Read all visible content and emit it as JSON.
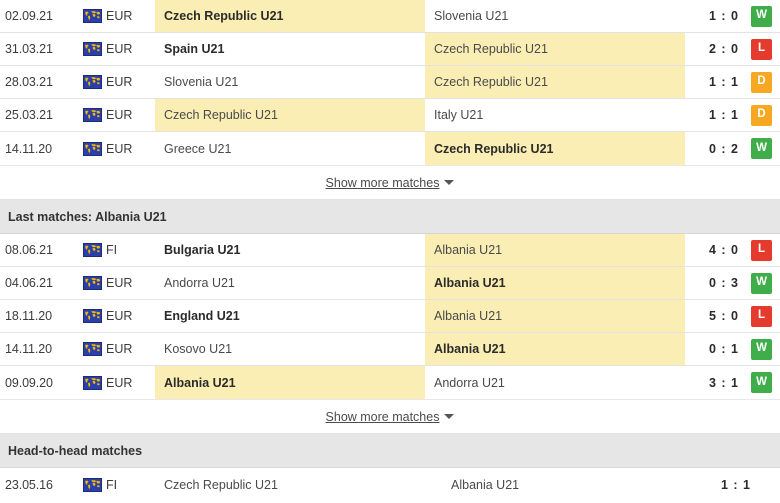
{
  "colors": {
    "win": "#3fae4a",
    "loss": "#e53b2e",
    "draw": "#f7a823",
    "highlight": "#faeeb4",
    "section_bg": "#e6e6e6",
    "flag_bg": "#2b3fa8",
    "flag_fg": "#f2b705"
  },
  "icons": {
    "flag": "world-map-icon",
    "caret": "chevron-down-icon"
  },
  "sections": {
    "czech": {
      "show_more_label": "Show more matches",
      "matches": [
        {
          "date": "02.09.21",
          "competition": "EUR",
          "home": "Czech Republic U21",
          "away": "Slovenia U21",
          "score": "1 : 0",
          "result": "W",
          "home_highlight": true,
          "away_highlight": false,
          "home_winner": true,
          "away_winner": false
        },
        {
          "date": "31.03.21",
          "competition": "EUR",
          "home": "Spain U21",
          "away": "Czech Republic U21",
          "score": "2 : 0",
          "result": "L",
          "home_highlight": false,
          "away_highlight": true,
          "home_winner": true,
          "away_winner": false
        },
        {
          "date": "28.03.21",
          "competition": "EUR",
          "home": "Slovenia U21",
          "away": "Czech Republic U21",
          "score": "1 : 1",
          "result": "D",
          "home_highlight": false,
          "away_highlight": true,
          "home_winner": false,
          "away_winner": false
        },
        {
          "date": "25.03.21",
          "competition": "EUR",
          "home": "Czech Republic U21",
          "away": "Italy U21",
          "score": "1 : 1",
          "result": "D",
          "home_highlight": true,
          "away_highlight": false,
          "home_winner": false,
          "away_winner": false
        },
        {
          "date": "14.11.20",
          "competition": "EUR",
          "home": "Greece U21",
          "away": "Czech Republic U21",
          "score": "0 : 2",
          "result": "W",
          "home_highlight": false,
          "away_highlight": true,
          "home_winner": false,
          "away_winner": true
        }
      ]
    },
    "albania": {
      "title": "Last matches: Albania U21",
      "show_more_label": "Show more matches",
      "matches": [
        {
          "date": "08.06.21",
          "competition": "FI",
          "home": "Bulgaria U21",
          "away": "Albania U21",
          "score": "4 : 0",
          "result": "L",
          "home_highlight": false,
          "away_highlight": true,
          "home_winner": true,
          "away_winner": false
        },
        {
          "date": "04.06.21",
          "competition": "EUR",
          "home": "Andorra U21",
          "away": "Albania U21",
          "score": "0 : 3",
          "result": "W",
          "home_highlight": false,
          "away_highlight": true,
          "home_winner": false,
          "away_winner": true
        },
        {
          "date": "18.11.20",
          "competition": "EUR",
          "home": "England U21",
          "away": "Albania U21",
          "score": "5 : 0",
          "result": "L",
          "home_highlight": false,
          "away_highlight": true,
          "home_winner": true,
          "away_winner": false
        },
        {
          "date": "14.11.20",
          "competition": "EUR",
          "home": "Kosovo U21",
          "away": "Albania U21",
          "score": "0 : 1",
          "result": "W",
          "home_highlight": false,
          "away_highlight": true,
          "home_winner": false,
          "away_winner": true
        },
        {
          "date": "09.09.20",
          "competition": "EUR",
          "home": "Albania U21",
          "away": "Andorra U21",
          "score": "3 : 1",
          "result": "W",
          "home_highlight": true,
          "away_highlight": false,
          "home_winner": true,
          "away_winner": false
        }
      ]
    },
    "h2h": {
      "title": "Head-to-head matches",
      "matches": [
        {
          "date": "23.05.16",
          "competition": "FI",
          "home": "Czech Republic U21",
          "away": "Albania U21",
          "score": "1 : 1"
        }
      ]
    }
  }
}
